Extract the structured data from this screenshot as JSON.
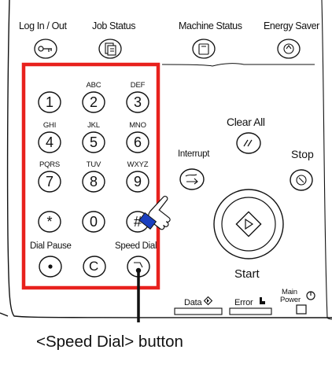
{
  "top_buttons": {
    "login_label": "Log In / Out",
    "job_status_label": "Job Status",
    "machine_status_label": "Machine Status",
    "energy_saver_label": "Energy Saver"
  },
  "keypad": {
    "keys": [
      {
        "symbol": "1",
        "letters": ""
      },
      {
        "symbol": "2",
        "letters": "ABC"
      },
      {
        "symbol": "3",
        "letters": "DEF"
      },
      {
        "symbol": "4",
        "letters": "GHI"
      },
      {
        "symbol": "5",
        "letters": "JKL"
      },
      {
        "symbol": "6",
        "letters": "MNO"
      },
      {
        "symbol": "7",
        "letters": "PQRS"
      },
      {
        "symbol": "8",
        "letters": "TUV"
      },
      {
        "symbol": "9",
        "letters": "WXYZ"
      },
      {
        "symbol": "*",
        "letters": ""
      },
      {
        "symbol": "0",
        "letters": ""
      },
      {
        "symbol": "#",
        "letters": ""
      }
    ],
    "dial_pause_label": "Dial Pause",
    "c_key": "C",
    "speed_dial_label": "Speed Dial"
  },
  "controls": {
    "clear_all_label": "Clear All",
    "interrupt_label": "Interrupt",
    "stop_label": "Stop",
    "start_label": "Start"
  },
  "indicators": {
    "data_label": "Data",
    "error_label": "Error",
    "main_power_line1": "Main",
    "main_power_line2": "Power"
  },
  "caption": "<Speed Dial> button",
  "colors": {
    "highlight": "#e8211d",
    "ink": "#111111",
    "pointer_hand": "#1a3fbf"
  }
}
